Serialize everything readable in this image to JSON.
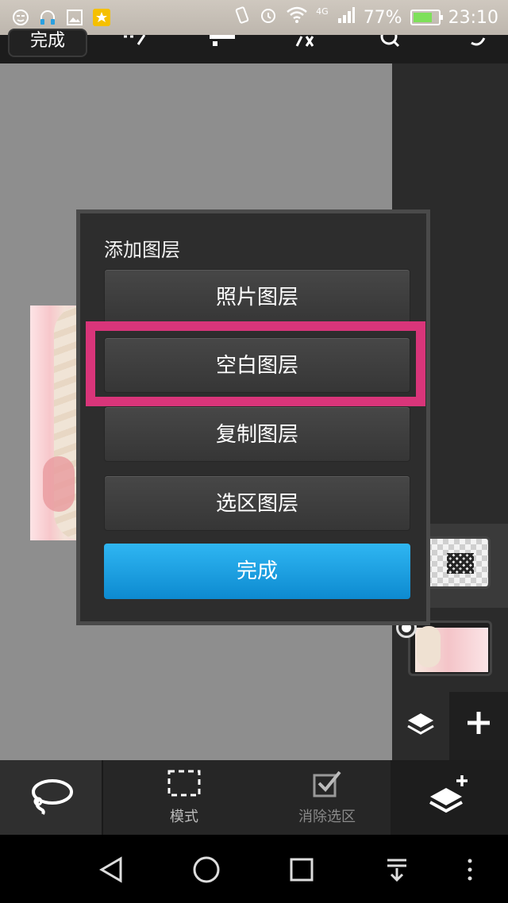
{
  "status_bar": {
    "network": "4G",
    "battery": "77%",
    "battery_level": 0.77,
    "time": "23:10",
    "icons": [
      "face-icon",
      "headset-icon",
      "image-icon",
      "star-icon",
      "vibrate-icon",
      "alarm-icon",
      "wifi-icon",
      "signal-icon",
      "battery-icon"
    ]
  },
  "top_toolbar": {
    "done_label": "完成",
    "icons": [
      "selection-edit-icon",
      "align-icon",
      "fx-icon",
      "search-icon",
      "redo-icon"
    ]
  },
  "dialog": {
    "title": "添加图层",
    "options": [
      "照片图层",
      "空白图层",
      "复制图层",
      "选区图层"
    ],
    "done_label": "完成",
    "highlighted_option": "空白图层",
    "highlight_color": "#d9357a",
    "done_color": "#1aa0e4"
  },
  "layers_panel": {
    "icons": [
      "layers-icon",
      "plus-icon"
    ]
  },
  "bottom_toolbar": {
    "items": [
      {
        "icon": "lasso-icon",
        "label": ""
      },
      {
        "icon": "marquee-icon",
        "label": "模式"
      },
      {
        "icon": "clear-check-icon",
        "label": "消除选区"
      },
      {
        "icon": "add-layer-icon",
        "label": ""
      }
    ]
  },
  "nav_bar": {
    "icons": [
      "back-icon",
      "home-icon",
      "recents-icon",
      "notifications-icon",
      "more-icon"
    ]
  }
}
